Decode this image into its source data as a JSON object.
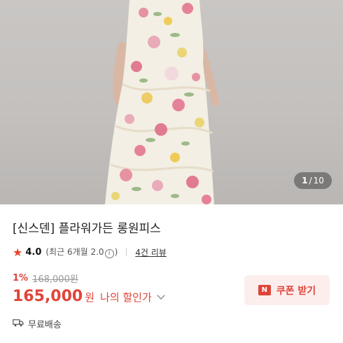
{
  "gallery": {
    "current_page": "1",
    "separator": "/",
    "total_pages": "10"
  },
  "product": {
    "title": "[신스덴] 플라워가든 롱원피스",
    "rating": "4.0",
    "rating_meta_prefix": "(최근 6개월 2.0",
    "rating_meta_suffix": ")",
    "info_symbol": "i",
    "review_link": "4건 리뷰",
    "discount_rate": "1%",
    "original_price": "168,000원",
    "price": "165,000",
    "currency": "원",
    "discount_label": "나의 할인가",
    "coupon_icon_text": "N",
    "coupon_label": "쿠폰 받기",
    "shipping": "무료배송"
  },
  "icons": {
    "rating": "star-icon",
    "info": "info-icon",
    "expand": "chevron-down-icon",
    "coupon": "coupon-icon",
    "shipping": "truck-icon"
  },
  "colors": {
    "accent": "#e0453a",
    "coupon_bg": "#fdeeee",
    "star": "#e8422c"
  }
}
